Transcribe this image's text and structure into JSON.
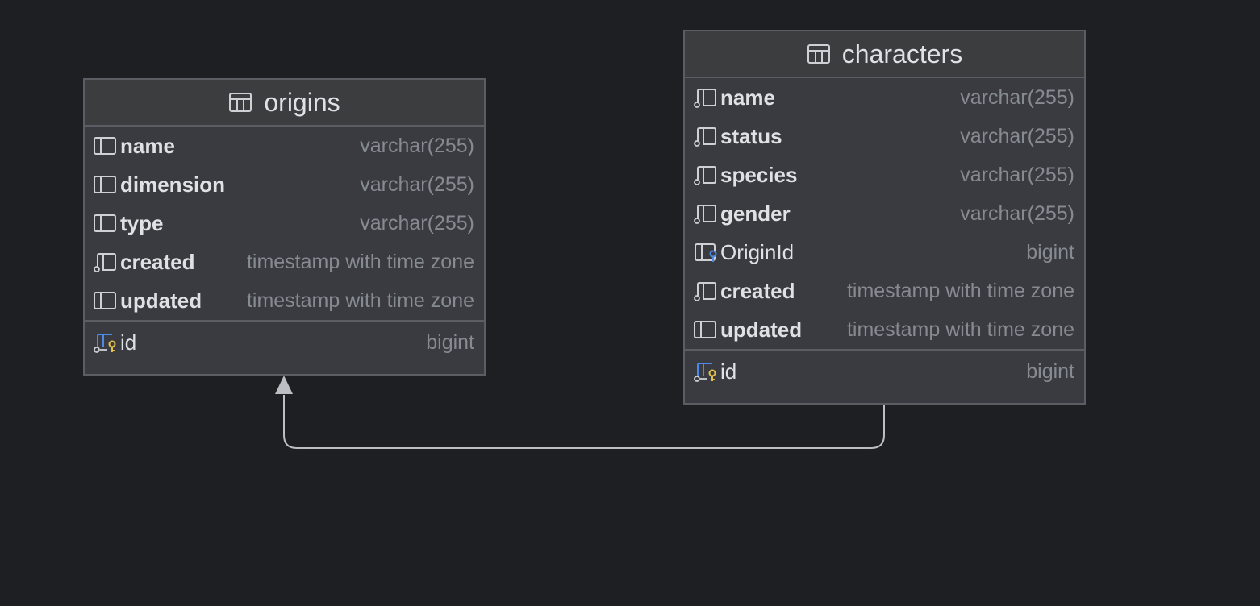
{
  "colors": {
    "background": "#1e1f22",
    "table_body": "#393b40",
    "table_header": "#3c3d3f",
    "border": "#5a5d63",
    "column_name": "#dfe1e5",
    "column_type": "#868a91",
    "key_gold": "#e6c04a",
    "key_blue": "#4d8ae8",
    "connector": "#bcbec4"
  },
  "origins": {
    "title": "origins",
    "columns": [
      {
        "name": "name",
        "type": "varchar(255)"
      },
      {
        "name": "dimension",
        "type": "varchar(255)"
      },
      {
        "name": "type",
        "type": "varchar(255)"
      },
      {
        "name": "created",
        "type": "timestamp with time zone"
      },
      {
        "name": "updated",
        "type": "timestamp with time zone"
      }
    ],
    "pk": {
      "name": "id",
      "type": "bigint"
    }
  },
  "characters": {
    "title": "characters",
    "columns": [
      {
        "name": "name",
        "type": "varchar(255)"
      },
      {
        "name": "status",
        "type": "varchar(255)"
      },
      {
        "name": "species",
        "type": "varchar(255)"
      },
      {
        "name": "gender",
        "type": "varchar(255)"
      },
      {
        "name": "OriginId",
        "type": "bigint"
      },
      {
        "name": "created",
        "type": "timestamp with time zone"
      },
      {
        "name": "updated",
        "type": "timestamp with time zone"
      }
    ],
    "pk": {
      "name": "id",
      "type": "bigint"
    }
  }
}
